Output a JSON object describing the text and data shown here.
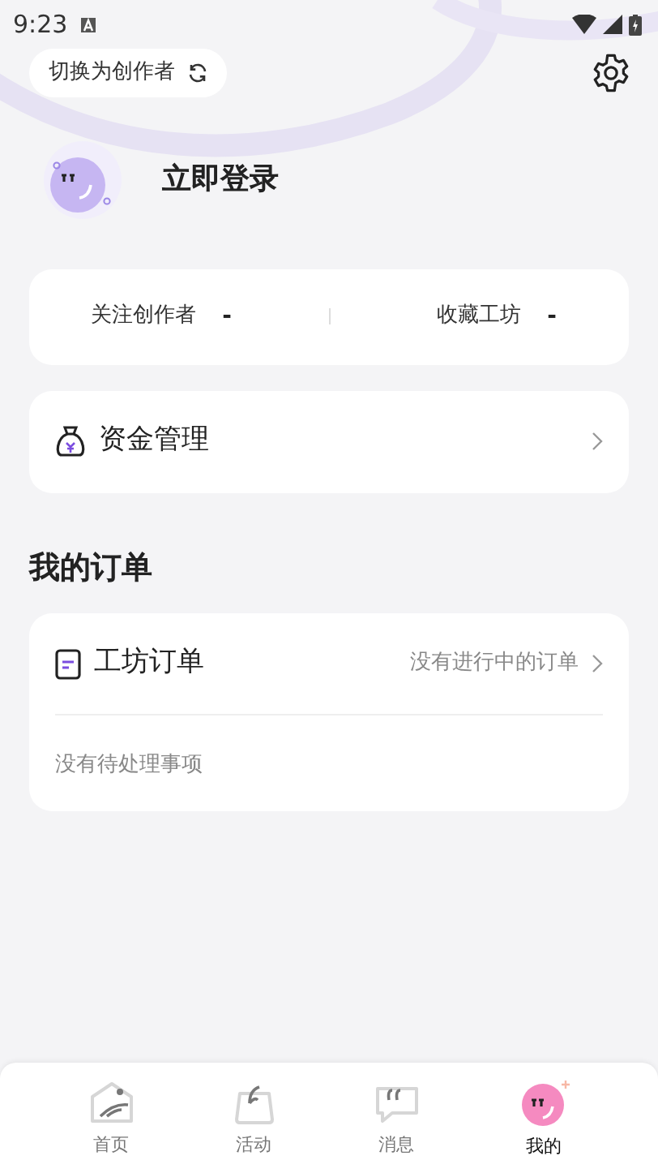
{
  "status_bar": {
    "time": "9:23"
  },
  "switch_button": {
    "label": "切换为创作者"
  },
  "login": {
    "label": "立即登录"
  },
  "stats": [
    {
      "label": "关注创作者",
      "value": "-"
    },
    {
      "label": "收藏工坊",
      "value": "-"
    }
  ],
  "funds": {
    "label": "资金管理"
  },
  "orders": {
    "heading": "我的订单",
    "title": "工坊订单",
    "status": "没有进行中的订单",
    "empty": "没有待处理事项"
  },
  "tabs": [
    {
      "label": "首页",
      "kind": "home",
      "selected": false
    },
    {
      "label": "活动",
      "kind": "activity",
      "selected": false
    },
    {
      "label": "消息",
      "kind": "message",
      "selected": false
    },
    {
      "label": "我的",
      "kind": "profile",
      "selected": true
    }
  ]
}
